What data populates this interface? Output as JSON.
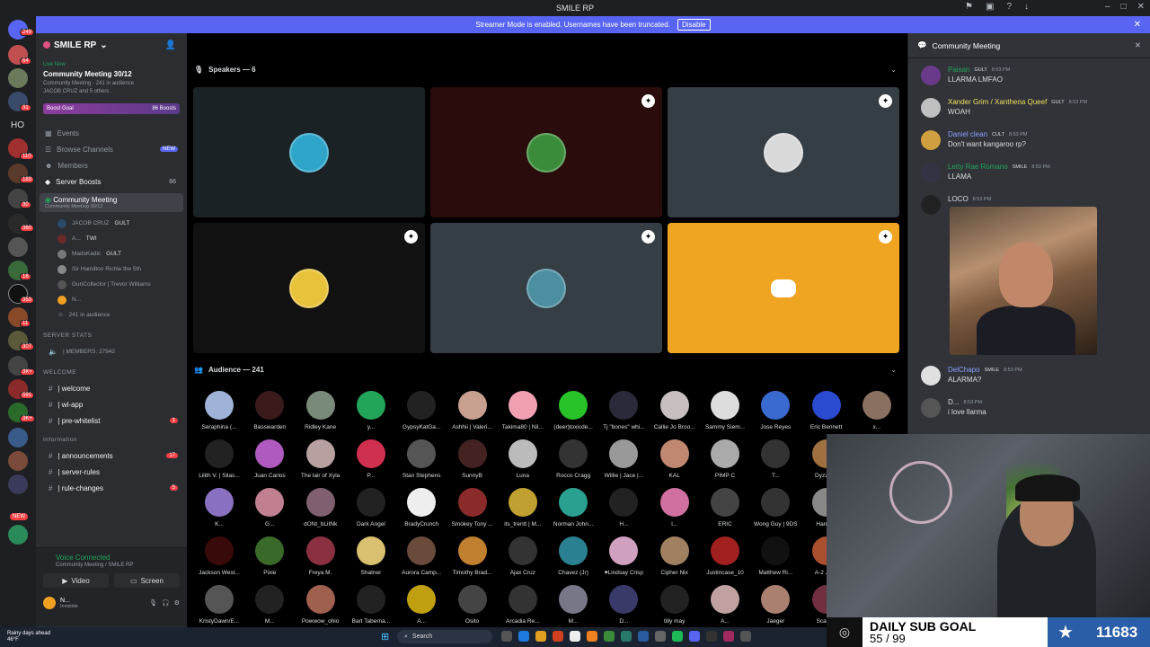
{
  "window": {
    "title": "SMILE RP"
  },
  "banner": {
    "text": "Streamer Mode is enabled. Usernames have been truncated.",
    "button": "Disable"
  },
  "rail": {
    "ho_label": "HO",
    "badges": [
      "249",
      "64",
      "31",
      "110",
      "183",
      "30",
      "360",
      "16",
      "353",
      "11",
      "307",
      "3K+",
      "591",
      "3K+",
      "NEW"
    ]
  },
  "server": {
    "name": "SMILE RP"
  },
  "live_event": {
    "status": "Live Now",
    "title": "Community Meeting 30/12",
    "sub1": "Community Meeting",
    "audience": "241 in audience",
    "sub2": "JACOB CRUZ and 5 others"
  },
  "boost": {
    "label": "Boost Goal",
    "count": "86 Boosts"
  },
  "nav": [
    {
      "label": "Events"
    },
    {
      "label": "Browse Channels",
      "badge": "NEW"
    },
    {
      "label": "Members"
    },
    {
      "label": "Server Boosts",
      "count": "66"
    }
  ],
  "selected_channel": {
    "name": "Community Meeting",
    "sub": "Community Meeting 30/12"
  },
  "stage_users": [
    {
      "name": "JACOB CRUZ",
      "tag": "GULT"
    },
    {
      "name": "A...",
      "tag": "TWI"
    },
    {
      "name": "MadsKadic",
      "tag": "GULT"
    },
    {
      "name": "Sir Hamilton Richie the 5th",
      "tag": ""
    },
    {
      "name": "GunCollector | Trevor Williams",
      "tag": ""
    },
    {
      "name": "N...",
      "tag": ""
    },
    {
      "name": "241 in audience",
      "tag": ""
    }
  ],
  "categories": {
    "stats": "SERVER STATS",
    "members": "| MEMBERS: 27942",
    "welcome": "WELCOME",
    "information": "Information"
  },
  "channels_welcome": [
    {
      "name": "| welcome"
    },
    {
      "name": "| wl-app"
    },
    {
      "name": "| pre-whitelist",
      "badge": "1"
    }
  ],
  "channels_info": [
    {
      "name": "| announcements",
      "badge": "17"
    },
    {
      "name": "| server-rules"
    },
    {
      "name": "| rule-changes",
      "badge": "5"
    }
  ],
  "voice": {
    "status": "Voice Connected",
    "channel": "Community Meeting / SMILE RP",
    "video": "Video",
    "screen": "Screen"
  },
  "me": {
    "name": "N...",
    "status": "Invisible"
  },
  "stage": {
    "speakers_label": "Speakers — 6",
    "audience_label": "Audience — 241"
  },
  "speakers": [
    {
      "color": "#1a2226",
      "avatar": "#2fa6c9"
    },
    {
      "color": "#2a0c0c",
      "avatar": "#3a8c3a"
    },
    {
      "color": "#353d45",
      "avatar": "#d9d9d9"
    },
    {
      "color": "#121212",
      "avatar": "#e8c23a"
    },
    {
      "color": "#353d45",
      "avatar": "#4b8fa0"
    },
    {
      "color": "#f0a522",
      "avatar": "#f0a522"
    }
  ],
  "audience": [
    {
      "name": "Seraphina (...",
      "c": "#9fb3d8"
    },
    {
      "name": "Basswarden",
      "c": "#3a1a1a"
    },
    {
      "name": "Ridley Kane",
      "c": "#7a8a7a"
    },
    {
      "name": "y...",
      "c": "#23a559"
    },
    {
      "name": "GypsyKatGa...",
      "c": "#222"
    },
    {
      "name": "Ashhii | Valeri...",
      "c": "#c8a090"
    },
    {
      "name": "Takima80 | Nil...",
      "c": "#f0a0b0"
    },
    {
      "name": "(deer)toxicde...",
      "c": "#29c229"
    },
    {
      "name": "Tj \"bones\" whi...",
      "c": "#2a2a3a"
    },
    {
      "name": "Callie Jo Broo...",
      "c": "#c8c0c0"
    },
    {
      "name": "Sammy Siem...",
      "c": "#dddddd"
    },
    {
      "name": "Jose Reyes",
      "c": "#3a6ad0"
    },
    {
      "name": "Eric Bennett",
      "c": "#2a4ad0"
    },
    {
      "name": "x...",
      "c": "#8a7060"
    },
    {
      "name": "Lilith V. | Silas...",
      "c": "#222"
    },
    {
      "name": "Juan Carlos",
      "c": "#b05ac0"
    },
    {
      "name": "The lair of Xyla",
      "c": "#b8a0a0"
    },
    {
      "name": "P...",
      "c": "#d03050"
    },
    {
      "name": "Stan Stephens",
      "c": "#555"
    },
    {
      "name": "SunnyB",
      "c": "#442222"
    },
    {
      "name": "Luna",
      "c": "#bbbbbb"
    },
    {
      "name": "Rocco Cragg",
      "c": "#333"
    },
    {
      "name": "Willie | Jace |...",
      "c": "#999"
    },
    {
      "name": "KAL",
      "c": "#c08870"
    },
    {
      "name": "PIMP C",
      "c": "#aaa"
    },
    {
      "name": "T...",
      "c": "#333"
    },
    {
      "name": "Dyzzie T",
      "c": "#a07040"
    },
    {
      "name": "K...",
      "c": "#8a70c0"
    },
    {
      "name": "G...",
      "c": "#c08090"
    },
    {
      "name": "dONt_bLiINk",
      "c": "#806070"
    },
    {
      "name": "Dark Angel",
      "c": "#222"
    },
    {
      "name": "BradyCrunch",
      "c": "#eee"
    },
    {
      "name": "Smokey Tony ...",
      "c": "#8a2a2a"
    },
    {
      "name": "its_trentt | M...",
      "c": "#c0a030"
    },
    {
      "name": "Norman John...",
      "c": "#2aa090"
    },
    {
      "name": "H...",
      "c": "#222"
    },
    {
      "name": "I...",
      "c": "#d070a0"
    },
    {
      "name": "ERIC",
      "c": "#444"
    },
    {
      "name": "Wong Guy | 9DS",
      "c": "#333"
    },
    {
      "name": "Harry R",
      "c": "#888"
    },
    {
      "name": "Jackson West...",
      "c": "#3a0a0a"
    },
    {
      "name": "Pixie",
      "c": "#3a6a2a"
    },
    {
      "name": "Freya M.",
      "c": "#8a3040"
    },
    {
      "name": "Shatner",
      "c": "#d8c070"
    },
    {
      "name": "Aurora Camp...",
      "c": "#6a4a3a"
    },
    {
      "name": "Timothy Brad...",
      "c": "#c08030"
    },
    {
      "name": "Ajax Cruz",
      "c": "#333"
    },
    {
      "name": "Chavez (Jr)",
      "c": "#2a8090"
    },
    {
      "name": "♥Lindsay Crisp",
      "c": "#d0a0c0"
    },
    {
      "name": "Cipher Nix",
      "c": "#a08060"
    },
    {
      "name": "Justincase_10",
      "c": "#a02020"
    },
    {
      "name": "Matthew Ri...",
      "c": "#111"
    },
    {
      "name": "A-2 Jens",
      "c": "#aa5030"
    },
    {
      "name": "KristyDawn/E...",
      "c": "#555"
    },
    {
      "name": "M...",
      "c": "#222"
    },
    {
      "name": "Powwow_ohio",
      "c": "#a06050"
    },
    {
      "name": "Bart Taberna...",
      "c": "#222"
    },
    {
      "name": "A...",
      "c": "#c0a010"
    },
    {
      "name": "Osito",
      "c": "#444"
    },
    {
      "name": "Arcadia Re...",
      "c": "#333"
    },
    {
      "name": "M...",
      "c": "#778"
    },
    {
      "name": "D...",
      "c": "#3a3a6a"
    },
    {
      "name": "tilly may",
      "c": "#222"
    },
    {
      "name": "A...",
      "c": "#c0a0a0"
    },
    {
      "name": "Jaeger",
      "c": "#aa8070"
    },
    {
      "name": "Scarlett",
      "c": "#703040"
    }
  ],
  "chat": {
    "title": "Community Meeting",
    "messages": [
      {
        "author": "Paisan",
        "tag": "GULT",
        "time": "8:53 PM",
        "text": "LLARMA LMFAO",
        "color": "#23a559",
        "av": "#6a3a8a"
      },
      {
        "author": "Xander Grim / Xanthena Queef",
        "tag": "GULT",
        "time": "8:53 PM",
        "text": "WOAH",
        "color": "#f0e060",
        "av": "#c0c0c0"
      },
      {
        "author": "Daniel clean",
        "tag": "CULT",
        "time": "8:53 PM",
        "text": "Don't want kangaroo rp?",
        "color": "#8aa0ff",
        "av": "#d0a040"
      },
      {
        "author": "Letty Rae Romano",
        "tag": "SMILE",
        "time": "8:53 PM",
        "text": "LLAMA",
        "color": "#23a559",
        "av": "#334"
      },
      {
        "author": "LOCO",
        "tag": "",
        "time": "8:53 PM",
        "text": "",
        "color": "#dbdee1",
        "av": "#222"
      },
      {
        "author": "DelChapo",
        "tag": "SMILE",
        "time": "8:53 PM",
        "text": "ALARMA?",
        "color": "#8aa0ff",
        "av": "#e0e0e0"
      },
      {
        "author": "D...",
        "tag": "",
        "time": "8:53 PM",
        "text": "i love llarma",
        "color": "#dbdee1",
        "av": "#555"
      }
    ]
  },
  "overlay": {
    "goal_title": "DAILY SUB GOAL",
    "goal_progress": "55 / 99",
    "count": "11683"
  },
  "taskbar": {
    "weather1": "Rainy days ahead",
    "weather2": "46°F",
    "search": "Search"
  }
}
